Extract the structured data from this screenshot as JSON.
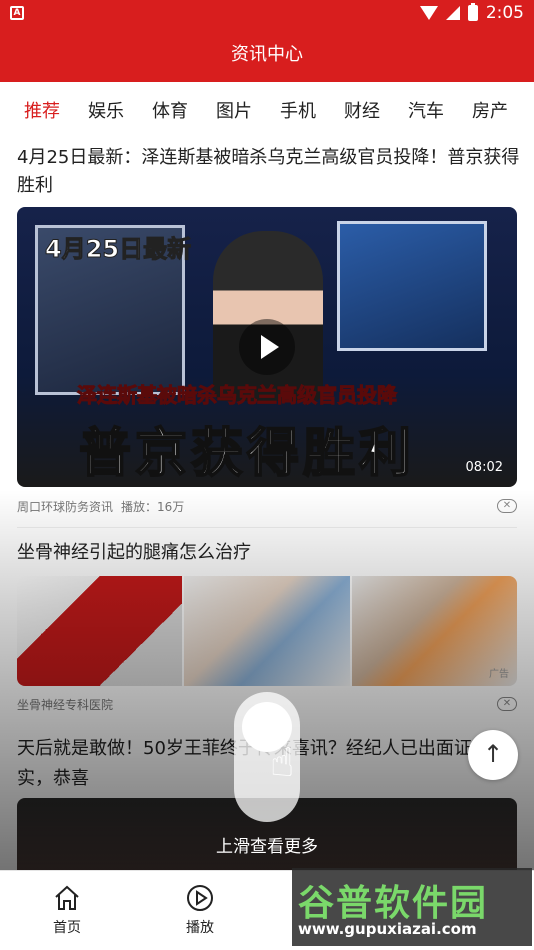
{
  "status_bar": {
    "time": "2:05",
    "left_icon": "A"
  },
  "header": {
    "title": "资讯中心"
  },
  "tabs": [
    {
      "label": "推荐",
      "active": true
    },
    {
      "label": "娱乐"
    },
    {
      "label": "体育"
    },
    {
      "label": "图片"
    },
    {
      "label": "手机"
    },
    {
      "label": "财经"
    },
    {
      "label": "汽车"
    },
    {
      "label": "房产"
    }
  ],
  "feed": {
    "item1": {
      "title": "4月25日最新：泽连斯基被暗杀乌克兰高级官员投降！普京获得胜利",
      "video_tag": "4月25日最新",
      "video_banner": "泽连斯基被暗杀乌克兰高级官员投降",
      "video_headline": "普京获得胜利",
      "duration": "08:02",
      "source": "周口环球防务资讯",
      "plays": "播放：16万"
    },
    "item2": {
      "title": "坐骨神经引起的腿痛怎么治疗",
      "ad_label": "广告",
      "source": "坐骨神经专科医院"
    },
    "item3": {
      "title": "天后就是敢做！50岁王菲终于传来喜讯？经纪人已出面证实，恭喜"
    }
  },
  "swipe_hint": {
    "text": "上滑查看更多"
  },
  "back_to_top": {
    "icon": "arrow-up-icon"
  },
  "bottom_nav": {
    "home": {
      "label": "首页",
      "icon": "home-icon"
    },
    "play": {
      "label": "播放",
      "icon": "play-circle-icon"
    }
  },
  "watermark": {
    "title": "谷普软件园",
    "url": "www.gupuxiazai.com"
  },
  "colors": {
    "brand_red": "#d81e1e"
  }
}
